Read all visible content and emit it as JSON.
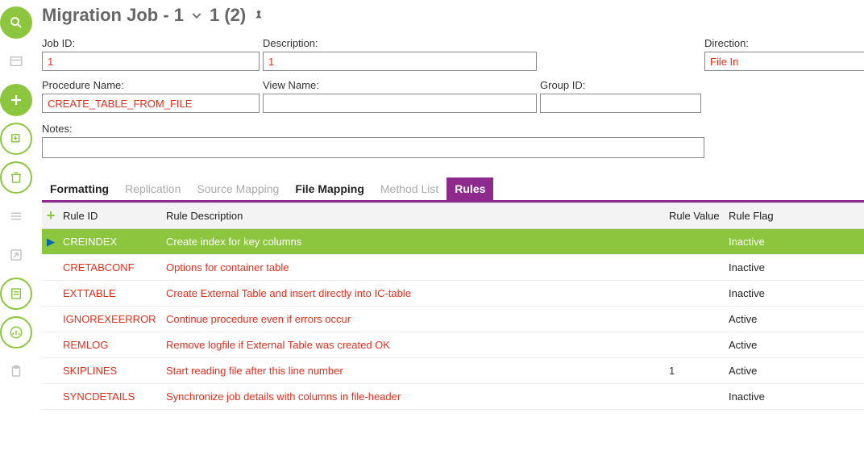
{
  "title": {
    "prefix": "Migration Job - 1",
    "suffix": "1 (2)"
  },
  "fields": {
    "job_id": {
      "label": "Job ID:",
      "value": "1"
    },
    "description": {
      "label": "Description:",
      "value": "1"
    },
    "direction": {
      "label": "Direction:",
      "value": "File In"
    },
    "procedure_name": {
      "label": "Procedure Name:",
      "value": "CREATE_TABLE_FROM_FILE"
    },
    "view_name": {
      "label": "View Name:",
      "value": ""
    },
    "group_id": {
      "label": "Group ID:",
      "value": ""
    },
    "notes": {
      "label": "Notes:",
      "value": ""
    }
  },
  "tabs": [
    {
      "label": "Formatting",
      "style": "dark"
    },
    {
      "label": "Replication",
      "style": "light"
    },
    {
      "label": "Source Mapping",
      "style": "light"
    },
    {
      "label": "File Mapping",
      "style": "dark"
    },
    {
      "label": "Method List",
      "style": "light"
    },
    {
      "label": "Rules",
      "style": "active"
    }
  ],
  "columns": {
    "rule_id": "Rule ID",
    "rule_description": "Rule Description",
    "rule_value": "Rule Value",
    "rule_flag": "Rule Flag"
  },
  "rows": [
    {
      "rule_id": "CREINDEX",
      "desc": "Create index for key columns",
      "value": "",
      "flag": "Inactive",
      "selected": true
    },
    {
      "rule_id": "CRETABCONF",
      "desc": "Options for container table",
      "value": "",
      "flag": "Inactive",
      "selected": false
    },
    {
      "rule_id": "EXTTABLE",
      "desc": "Create External Table and insert directly into IC-table",
      "value": "",
      "flag": "Inactive",
      "selected": false
    },
    {
      "rule_id": "IGNOREXEERROR",
      "desc": "Continue procedure even if errors occur",
      "value": "",
      "flag": "Active",
      "selected": false
    },
    {
      "rule_id": "REMLOG",
      "desc": "Remove logfile if External Table was created OK",
      "value": "",
      "flag": "Active",
      "selected": false
    },
    {
      "rule_id": "SKIPLINES",
      "desc": "Start reading file after this line number",
      "value": "1",
      "flag": "Active",
      "selected": false
    },
    {
      "rule_id": "SYNCDETAILS",
      "desc": "Synchronize job details with columns in file-header",
      "value": "",
      "flag": "Inactive",
      "selected": false
    }
  ]
}
